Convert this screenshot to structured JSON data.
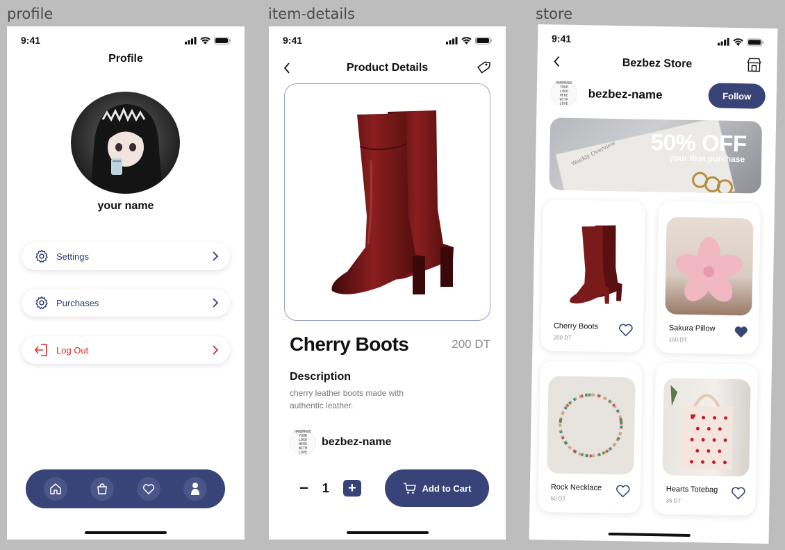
{
  "frames": {
    "profile_label": "profile",
    "item_label": "item-details",
    "store_label": "store"
  },
  "status_time": "9:41",
  "profile": {
    "title": "Profile",
    "username": "your name",
    "menu": [
      {
        "label": "Settings",
        "icon": "gear-icon"
      },
      {
        "label": "Purchases",
        "icon": "gear-icon"
      },
      {
        "label": "Log Out",
        "icon": "logout-icon"
      }
    ],
    "nav": [
      "home-icon",
      "bag-icon",
      "heart-icon",
      "profile-icon"
    ]
  },
  "item": {
    "title": "Product Details",
    "name": "Cherry Boots",
    "price": "200 DT",
    "desc_title": "Description",
    "desc_text": "cherry leather boots made with authentic leather.",
    "seller": "bezbez-name",
    "qty_minus": "−",
    "qty": "1",
    "qty_plus": "+",
    "add_to_cart": "Add to Cart",
    "logo_text": "HANDMADE YOUR LOGO HERE WITH LOVE"
  },
  "store": {
    "title": "Bezbez Store",
    "seller": "bezbez-name",
    "follow": "Follow",
    "banner_big": "50% OFF",
    "banner_small": "your first purchase",
    "banner_notebook": "Weekly Overview",
    "products": [
      {
        "name": "Cherry Boots",
        "price": "200 DT",
        "liked": false
      },
      {
        "name": "Sakura Pillow",
        "price": "150 DT",
        "liked": true
      },
      {
        "name": "Rock Necklace",
        "price": "50 DT",
        "liked": false
      },
      {
        "name": "Hearts Totebag",
        "price": "35 DT",
        "liked": false
      }
    ]
  },
  "colors": {
    "primary": "#384477",
    "danger": "#e02626",
    "boot": "#6b1414"
  }
}
